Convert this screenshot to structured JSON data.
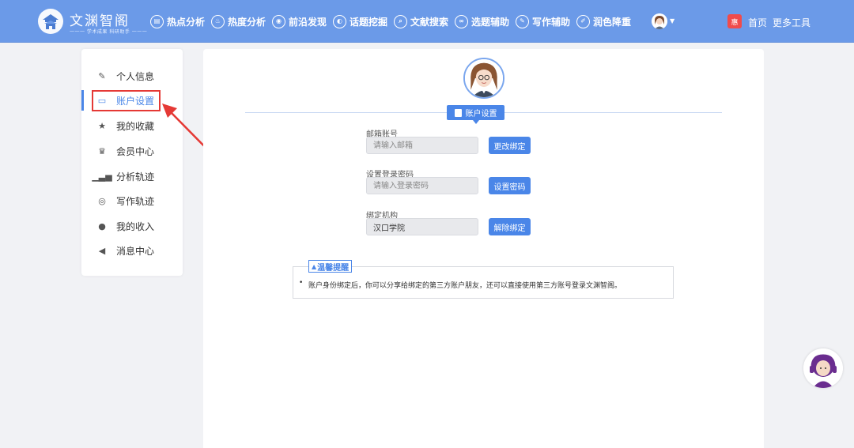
{
  "header": {
    "brand_title": "文渊智阁",
    "brand_subtitle": "一一一 学术成果 科研助手 一一一",
    "nav": [
      {
        "label": "热点分析",
        "icon": "document-icon"
      },
      {
        "label": "热度分析",
        "icon": "flame-icon"
      },
      {
        "label": "前沿发现",
        "icon": "target-icon"
      },
      {
        "label": "话题挖掘",
        "icon": "chat-icon"
      },
      {
        "label": "文献搜索",
        "icon": "search-icon"
      },
      {
        "label": "选题辅助",
        "icon": "link-icon"
      },
      {
        "label": "写作辅助",
        "icon": "pen-icon"
      },
      {
        "label": "润色降重",
        "icon": "brush-icon"
      }
    ],
    "badge": "惠",
    "home_label": "首页",
    "more_tools_label": "更多工具"
  },
  "sidebar": {
    "items": [
      {
        "label": "个人信息",
        "icon": "edit-icon"
      },
      {
        "label": "账户设置",
        "icon": "card-icon",
        "active": true
      },
      {
        "label": "我的收藏",
        "icon": "star-icon"
      },
      {
        "label": "会员中心",
        "icon": "crown-icon"
      },
      {
        "label": "分析轨迹",
        "icon": "chart-icon"
      },
      {
        "label": "写作轨迹",
        "icon": "target-icon"
      },
      {
        "label": "我的收入",
        "icon": "money-bag-icon"
      },
      {
        "label": "消息中心",
        "icon": "megaphone-icon"
      }
    ]
  },
  "main": {
    "section_title": "账户设置",
    "email": {
      "label": "邮箱账号",
      "placeholder": "请输入邮箱",
      "button": "更改绑定"
    },
    "password": {
      "label": "设置登录密码",
      "placeholder": "请输入登录密码",
      "button": "设置密码"
    },
    "institution": {
      "label": "绑定机构",
      "value": "汉口学院",
      "button": "解除绑定"
    },
    "tips": {
      "title": "温馨提醒",
      "text": "账户身份绑定后，你可以分享给绑定的第三方账户朋友，还可以直接使用第三方账号登录文渊智阁。"
    }
  },
  "colors": {
    "header": "#6b9ae8",
    "accent": "#4a86e8",
    "annotation": "#e53935"
  }
}
